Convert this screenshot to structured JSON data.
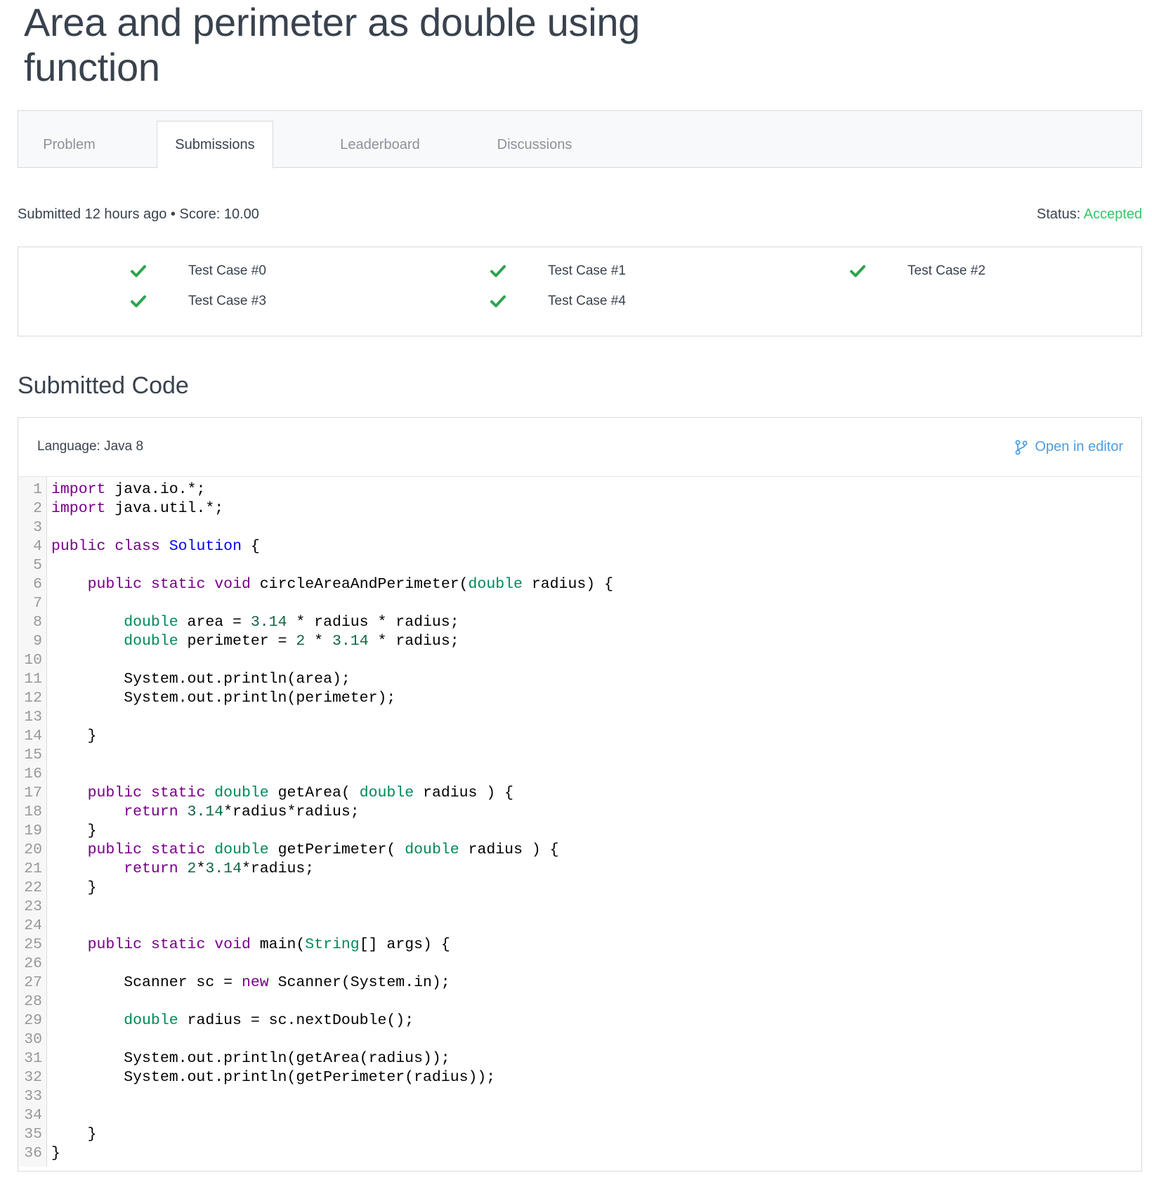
{
  "title": "Area and perimeter as double using function",
  "tabs": [
    {
      "label": "Problem",
      "active": false
    },
    {
      "label": "Submissions",
      "active": true
    },
    {
      "label": "Leaderboard",
      "active": false
    },
    {
      "label": "Discussions",
      "active": false
    }
  ],
  "submission": {
    "meta": "Submitted 12 hours ago • Score: 10.00",
    "status_label": "Status:",
    "status_value": "Accepted"
  },
  "test_cases": [
    {
      "label": "Test Case #0",
      "passed": true
    },
    {
      "label": "Test Case #1",
      "passed": true
    },
    {
      "label": "Test Case #2",
      "passed": true
    },
    {
      "label": "Test Case #3",
      "passed": true
    },
    {
      "label": "Test Case #4",
      "passed": true
    }
  ],
  "section_title": "Submitted Code",
  "code": {
    "language": "Language: Java 8",
    "open_in_editor": "Open in editor",
    "lines": [
      "import java.io.*;",
      "import java.util.*;",
      "",
      "public class Solution {",
      "",
      "    public static void circleAreaAndPerimeter(double radius) {",
      "",
      "        double area = 3.14 * radius * radius;",
      "        double perimeter = 2 * 3.14 * radius;",
      "",
      "        System.out.println(area);",
      "        System.out.println(perimeter);",
      "",
      "    }",
      "",
      "",
      "    public static double getArea( double radius ) {",
      "        return 3.14*radius*radius;",
      "    }",
      "    public static double getPerimeter( double radius ) {",
      "        return 2*3.14*radius;",
      "    }",
      "",
      "",
      "    public static void main(String[] args) {",
      "",
      "        Scanner sc = new Scanner(System.in);",
      "",
      "        double radius = sc.nextDouble();",
      "",
      "        System.out.println(getArea(radius));",
      "        System.out.println(getPerimeter(radius));",
      "",
      "",
      "    }",
      "}"
    ]
  },
  "colors": {
    "accepted": "#2ec866",
    "check": "#2ea44f",
    "link": "#4d9de0",
    "keyword": "#770088",
    "type": "#008855",
    "number": "#116644",
    "class_def": "#0000ff"
  }
}
